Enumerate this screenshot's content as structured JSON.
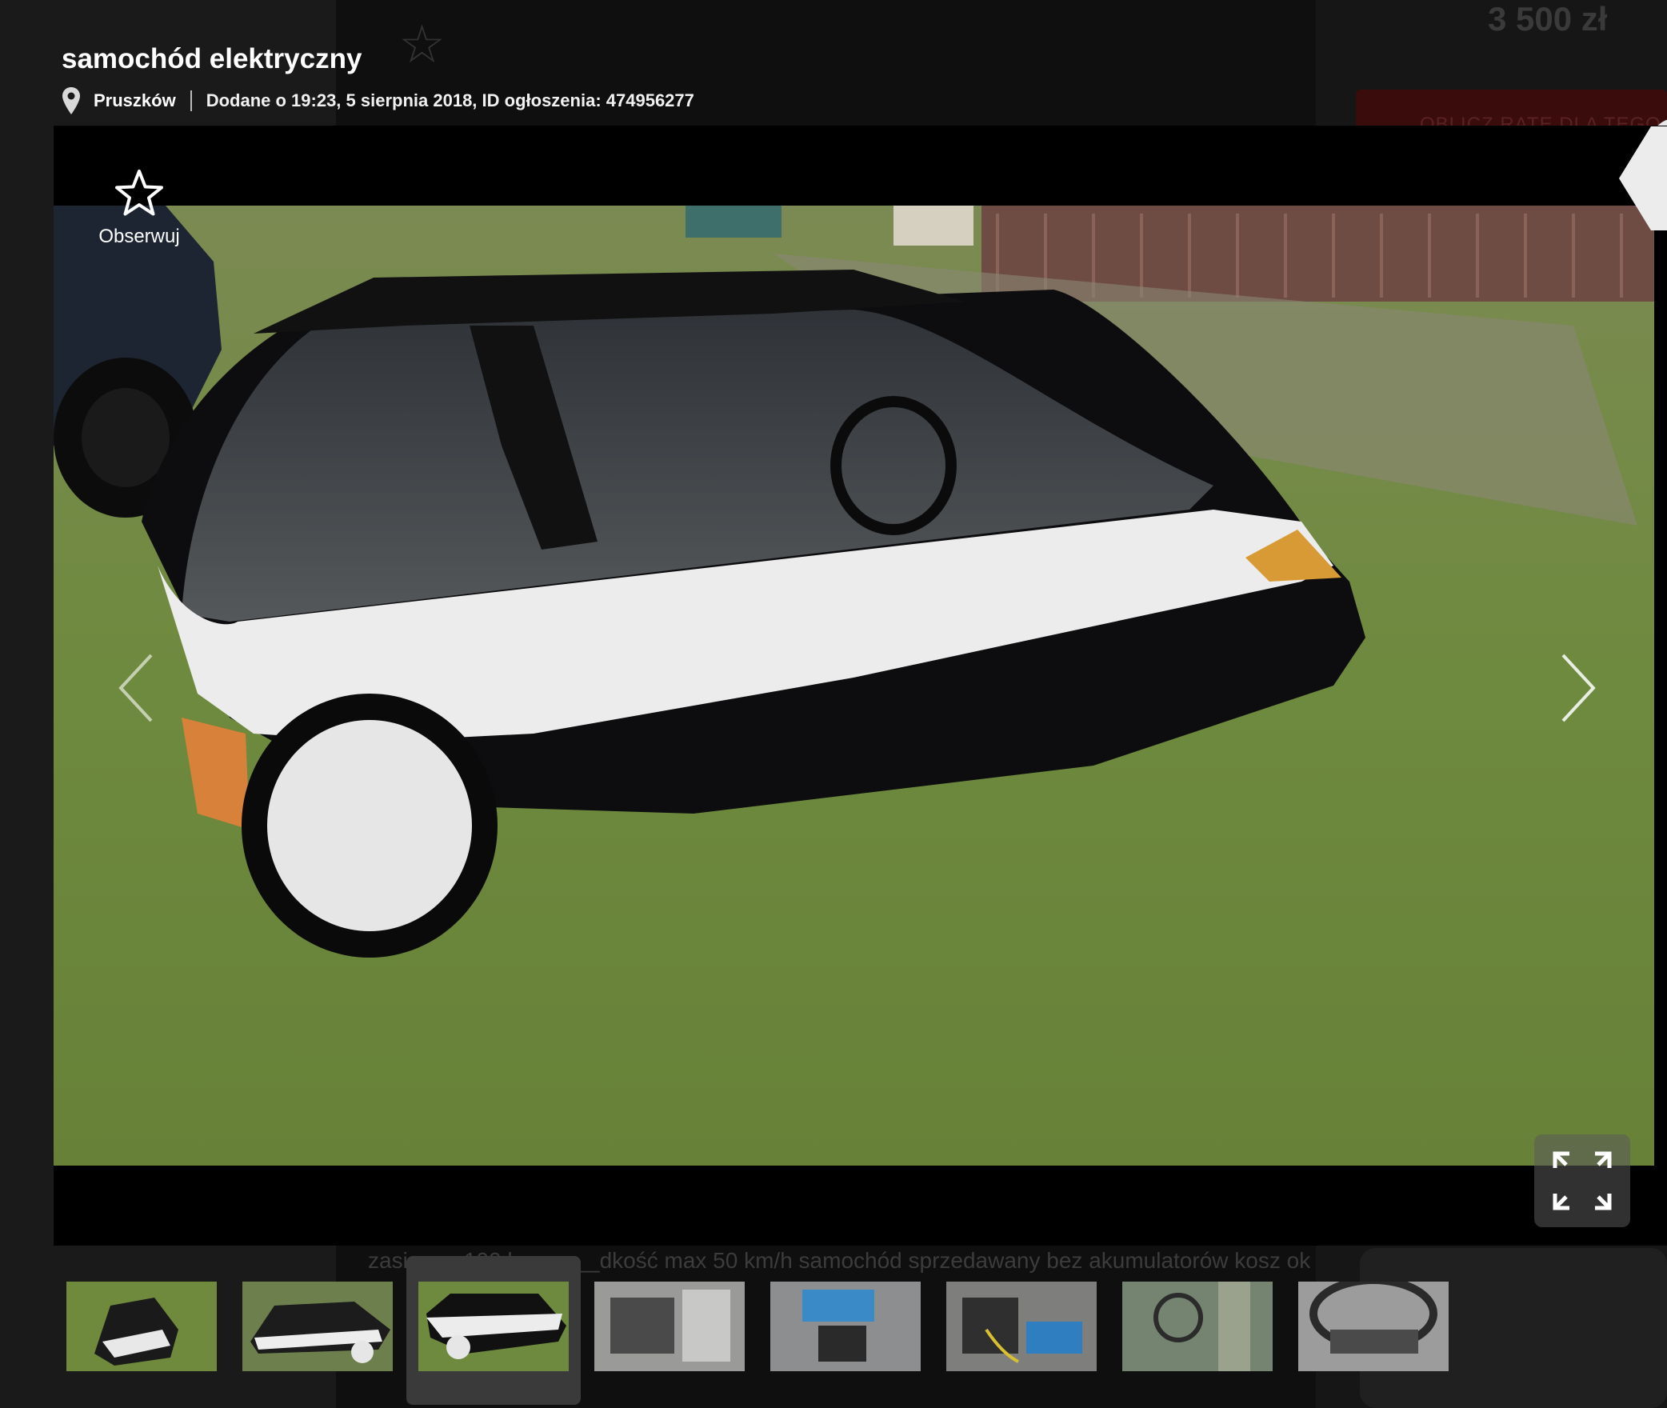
{
  "background": {
    "price": "3 500 zł",
    "red_button_label": "OBLICZ RATĘ DLA TEGO",
    "description_snippet": "zasię___ 100 k___ ___dkość max 50 km/h samochód sprzedawany bez akumulatorów kosz ok"
  },
  "header": {
    "title": "samochód elektryczny",
    "location": "Pruszków",
    "added": "Dodane o 19:23, 5 sierpnia 2018, ID ogłoszenia: 474956277"
  },
  "viewer": {
    "follow_label": "Obserwuj",
    "colors": {
      "accent": "#d8202e",
      "overlay": "#000000"
    }
  },
  "thumbnails": {
    "count": 8,
    "active_index": 2
  }
}
